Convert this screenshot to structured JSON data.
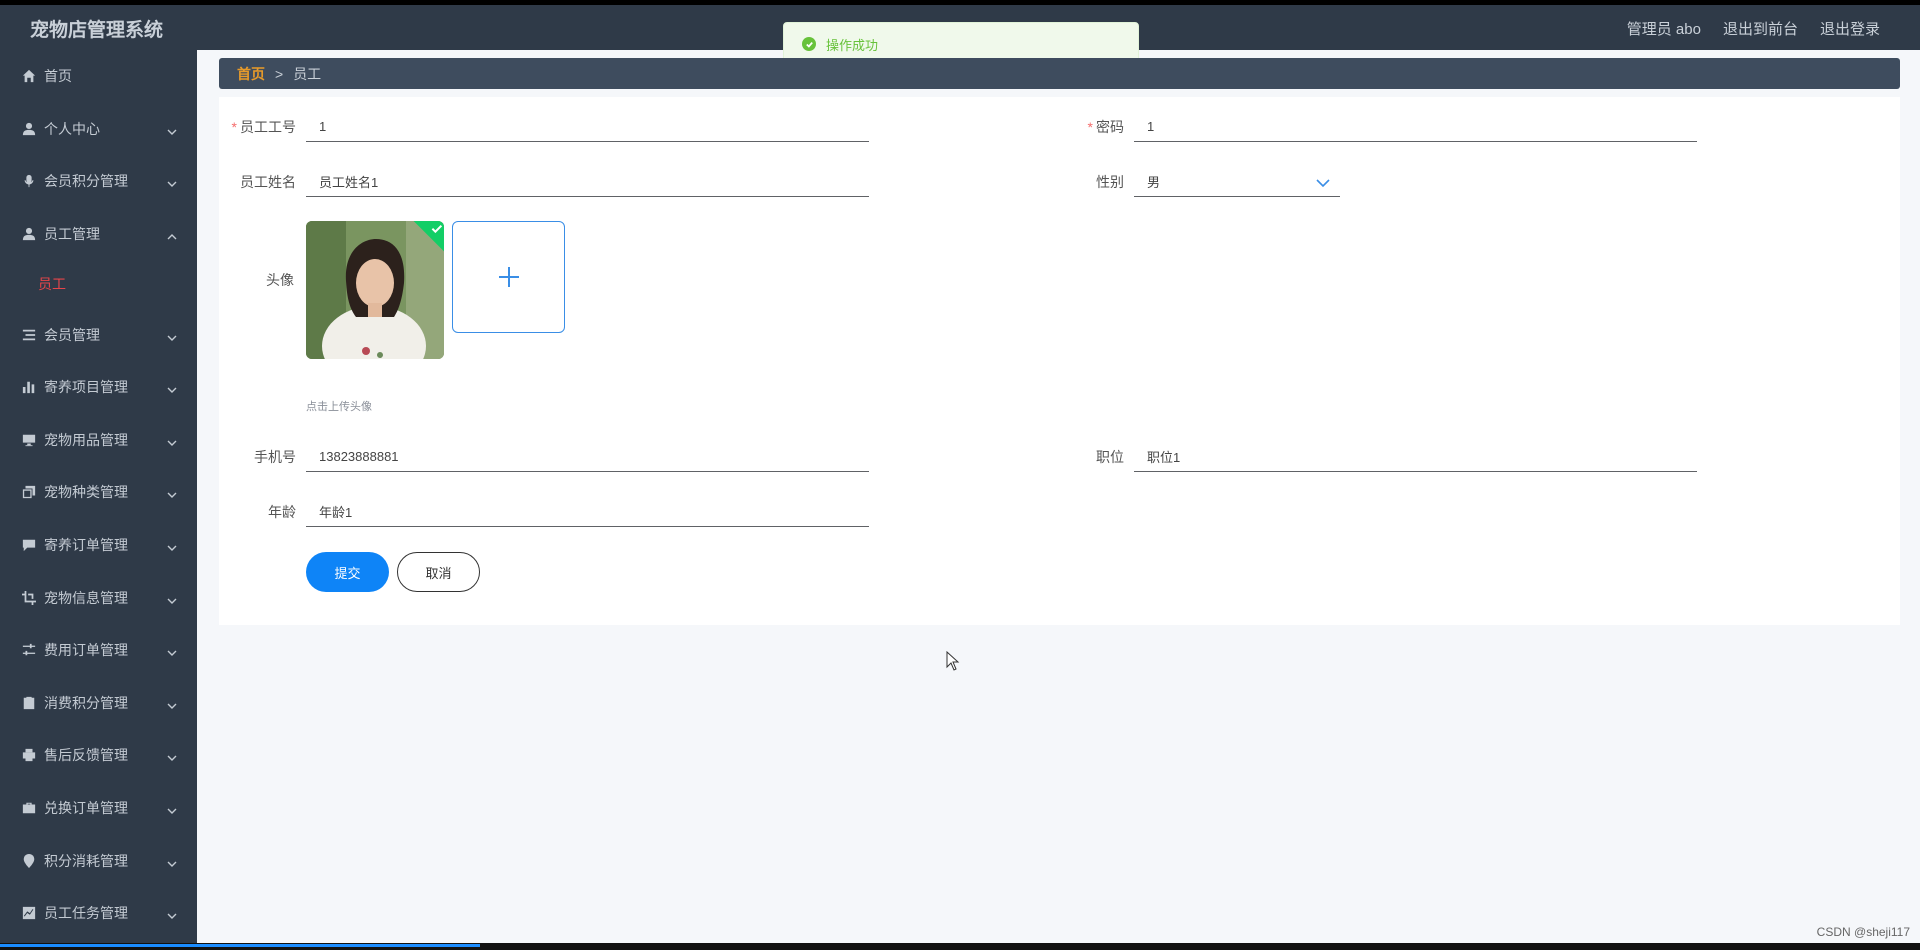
{
  "header": {
    "app_title": "宠物店管理系统",
    "user_label": "管理员 abo",
    "back_front": "退出到前台",
    "logout": "退出登录"
  },
  "toast": {
    "message": "操作成功"
  },
  "sidebar": {
    "items": [
      {
        "label": "首页",
        "icon": "home-icon"
      },
      {
        "label": "个人中心",
        "icon": "user-icon"
      },
      {
        "label": "会员积分管理",
        "icon": "microphone-icon"
      },
      {
        "label": "员工管理",
        "icon": "user-icon",
        "expanded": true
      },
      {
        "label": "员工",
        "submenu": true
      },
      {
        "label": "会员管理",
        "icon": "list-icon"
      },
      {
        "label": "寄养项目管理",
        "icon": "bar-chart-icon"
      },
      {
        "label": "宠物用品管理",
        "icon": "monitor-icon"
      },
      {
        "label": "宠物种类管理",
        "icon": "copy-icon"
      },
      {
        "label": "寄养订单管理",
        "icon": "chat-icon"
      },
      {
        "label": "宠物信息管理",
        "icon": "crop-icon"
      },
      {
        "label": "费用订单管理",
        "icon": "sliders-icon"
      },
      {
        "label": "消费积分管理",
        "icon": "clipboard-icon"
      },
      {
        "label": "售后反馈管理",
        "icon": "printer-icon"
      },
      {
        "label": "兑换订单管理",
        "icon": "briefcase-icon"
      },
      {
        "label": "积分消耗管理",
        "icon": "location-icon"
      },
      {
        "label": "员工任务管理",
        "icon": "trend-icon"
      }
    ]
  },
  "breadcrumb": {
    "home": "首页",
    "sep": ">",
    "current": "员工"
  },
  "form": {
    "employee_no": {
      "label": "员工工号",
      "value": "1"
    },
    "password": {
      "label": "密码",
      "value": "1"
    },
    "employee_name": {
      "label": "员工姓名",
      "value": "员工姓名1"
    },
    "gender": {
      "label": "性别",
      "value": "男"
    },
    "avatar": {
      "label": "头像",
      "tip": "点击上传头像"
    },
    "phone": {
      "label": "手机号",
      "value": "13823888881"
    },
    "position": {
      "label": "职位",
      "value": "职位1"
    },
    "age": {
      "label": "年龄",
      "value": "年龄1"
    },
    "submit": "提交",
    "cancel": "取消"
  },
  "watermark": "CSDN @sheji117",
  "colors": {
    "sidebar_bg": "#2f3a48",
    "active_sub": "#e6454a",
    "primary": "#0e84f7",
    "success": "#67c23a",
    "breadcrumb_home": "#e69a2a"
  }
}
